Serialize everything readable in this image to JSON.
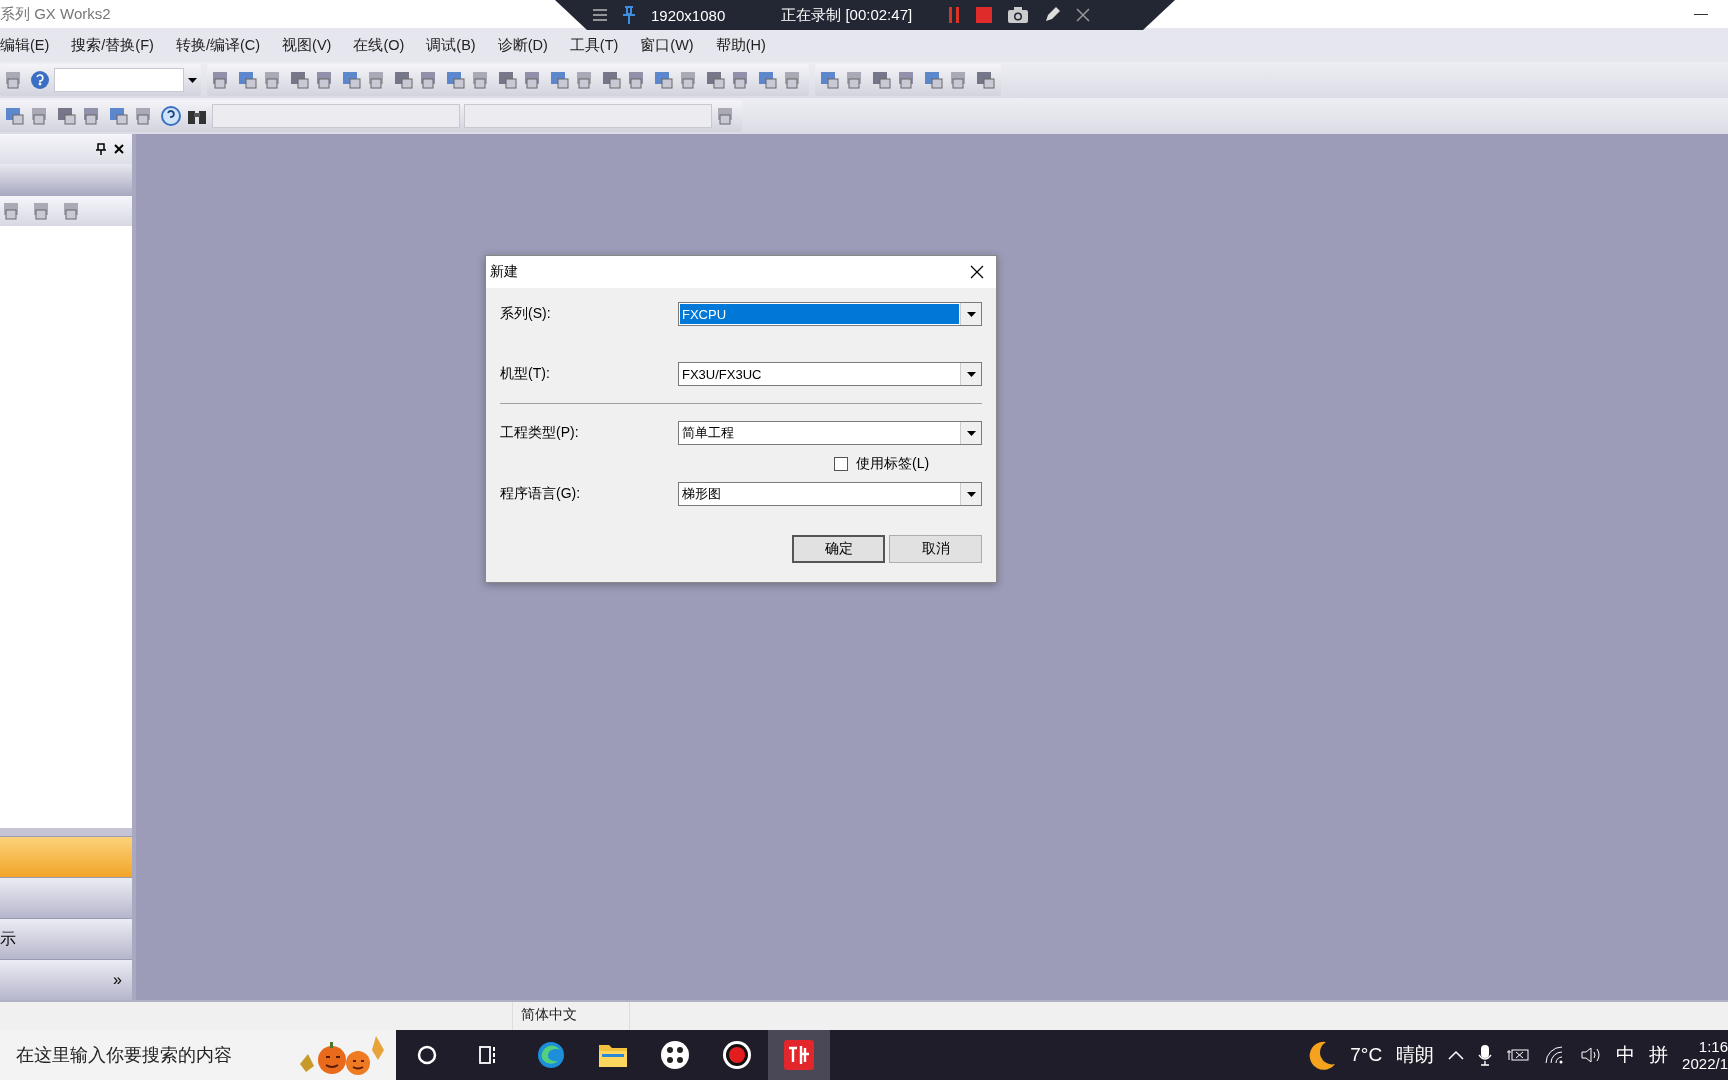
{
  "window": {
    "title": "系列 GX Works2"
  },
  "recorder": {
    "resolution": "1920x1080",
    "status": "正在录制 [00:02:47]"
  },
  "menu": [
    "编辑(E)",
    "搜索/替换(F)",
    "转换/编译(C)",
    "视图(V)",
    "在线(O)",
    "调试(B)",
    "诊断(D)",
    "工具(T)",
    "窗口(W)",
    "帮助(H)"
  ],
  "side_panel": {
    "bands": [
      {
        "kind": "active"
      },
      {
        "kind": "plain"
      },
      {
        "kind": "plain",
        "label": "示"
      },
      {
        "kind": "more",
        "label": "»"
      }
    ]
  },
  "dialog": {
    "title": "新建",
    "fields": [
      {
        "kind": "select",
        "label": "系列(S):",
        "value": "FXCPU",
        "selected": true
      },
      {
        "kind": "select",
        "label": "机型(T):",
        "value": "FX3U/FX3UC",
        "selected": false
      },
      {
        "kind": "separator"
      },
      {
        "kind": "select",
        "label": "工程类型(P):",
        "value": "简单工程",
        "selected": false
      },
      {
        "kind": "checkbox",
        "label": "使用标签(L)",
        "checked": false
      },
      {
        "kind": "select",
        "label": "程序语言(G):",
        "value": "梯形图",
        "selected": false
      }
    ],
    "buttons": [
      {
        "label": "确定",
        "default": true
      },
      {
        "label": "取消",
        "default": false
      }
    ]
  },
  "status_bar": [
    "简体中文"
  ],
  "taskbar": {
    "search": {
      "placeholder": "在这里输入你要搜索的内容"
    },
    "apps": [
      {
        "kind": "cortana",
        "active": false
      },
      {
        "kind": "taskview",
        "active": false
      },
      {
        "kind": "edge",
        "active": false
      },
      {
        "kind": "folder",
        "active": false
      },
      {
        "kind": "dots",
        "active": false
      },
      {
        "kind": "record",
        "active": false
      },
      {
        "kind": "gx",
        "active": true
      }
    ],
    "weather": {
      "temperature": "7°C",
      "condition": "晴朗"
    },
    "ime": [
      "中",
      "拼"
    ],
    "time": "1:16",
    "date": "2022/1"
  }
}
